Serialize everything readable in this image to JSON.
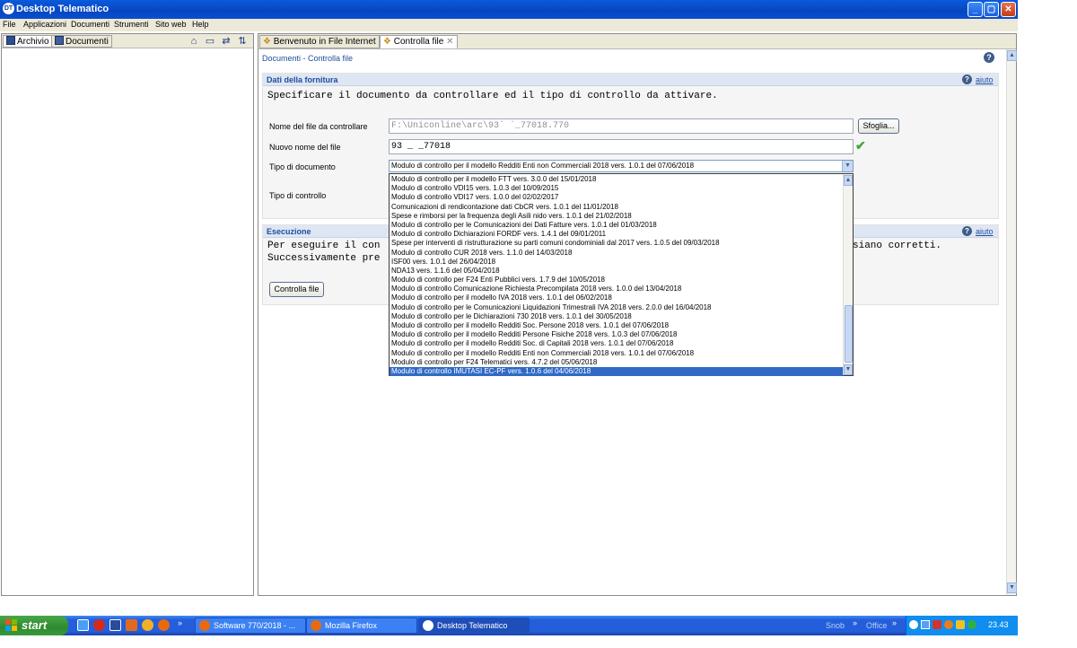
{
  "window": {
    "title": "Desktop Telematico",
    "app_icon_text": "DT",
    "minimize": "_",
    "maximize": "▢",
    "close": "✕"
  },
  "menu": [
    "File",
    "Applicazioni",
    "Documenti",
    "Strumenti",
    "Sito web",
    "Help"
  ],
  "left_panel": {
    "tabs": [
      "Archivio",
      "Documenti"
    ]
  },
  "right_panel": {
    "tabs": [
      "Benvenuto in File Internet",
      "Controlla file"
    ],
    "breadcrumb": "Documenti - Controlla file",
    "help_icon_text": "?"
  },
  "dati_fornitura": {
    "header": "Dati della fornitura",
    "aiuto": "aiuto",
    "instruction": "Specificare il documento da controllare ed il tipo di controllo da attivare.",
    "file_label": "Nome del file da controllare",
    "file_value": "F:\\Uniconline\\arc\\93`       `_77018.770",
    "browse_button": "Sfoglia...",
    "new_name_label": "Nuovo nome del file",
    "new_name_value": "93        _ _77018",
    "tipo_documento_label": "Tipo di documento",
    "tipo_documento_value": "Modulo di controllo per il modello Redditi Enti non Commerciali 2018 vers. 1.0.1 del 07/06/2018",
    "tipo_controllo_label": "Tipo di controllo"
  },
  "esecuzione": {
    "header": "Esecuzione",
    "aiuto": "aiuto",
    "line1_start": "Per eseguire il con",
    "line1_end": "siano corretti.",
    "line2_start": "Successivamente pre",
    "button": "Controlla file"
  },
  "dropdown_options": [
    "Modulo di controllo per il modello FTT vers. 3.0.0 del 15/01/2018",
    "Modulo di controllo VDI15 vers. 1.0.3 del 10/09/2015",
    "Modulo di controllo VDI17 vers. 1.0.0 del 02/02/2017",
    "Comunicazioni di rendicontazione dati CbCR vers. 1.0.1 del 11/01/2018",
    "Spese e rimborsi per la frequenza degli Asili nido vers. 1.0.1 del 21/02/2018",
    "Modulo di controllo per le Comunicazioni dei Dati Fatture vers. 1.0.1 del 01/03/2018",
    "Modulo di controllo Dichiarazioni FORDF vers. 1.4.1 del 09/01/2011",
    "Spese per interventi di ristrutturazione su parti comuni condominiali dal 2017 vers. 1.0.5 del 09/03/2018",
    "Modulo di controllo CUR 2018 vers. 1.1.0 del 14/03/2018",
    "ISF00 vers. 1.0.1 del 26/04/2018",
    "NDA13 vers. 1.1.6 del 05/04/2018",
    "Modulo di controllo per F24 Enti Pubblici vers. 1.7.9 del 10/05/2018",
    "Modulo di controllo Comunicazione Richiesta Precompilata 2018 vers. 1.0.0 del 13/04/2018",
    "Modulo di controllo per il modello IVA 2018 vers. 1.0.1 del 06/02/2018",
    "Modulo di controllo per le Comunicazioni Liquidazioni Trimestrali IVA 2018 vers. 2.0.0 del 16/04/2018",
    "Modulo di controllo per le Dichiarazioni 730 2018 vers. 1.0.1 del 30/05/2018",
    "Modulo di controllo per il modello Redditi Soc. Persone 2018 vers. 1.0.1 del 07/06/2018",
    "Modulo di controllo per il modello Redditi Persone Fisiche 2018 vers. 1.0.3 del 07/06/2018",
    "Modulo di controllo per il modello Redditi Soc. di Capitali 2018 vers. 1.0.1 del 07/06/2018",
    "Modulo di controllo per il modello Redditi Enti non Commerciali 2018 vers. 1.0.1 del 07/06/2018",
    "Modulo di controllo per F24 Telematici vers. 4.7.2 del 05/06/2018",
    "Modulo di controllo IMUTASI EC-PF vers. 1.0.6 del 04/06/2018"
  ],
  "dropdown_selected_index": 21,
  "taskbar": {
    "start": "start",
    "tasks": [
      "Software 770/2018 - ...",
      "Mozilla Firefox",
      "Desktop Telematico"
    ],
    "snob": "Snob",
    "office": "Office",
    "clock": "23.43"
  },
  "colors": {
    "titlebar": "#0a5bdc",
    "accent": "#1e4fa0",
    "selection": "#316ac5",
    "taskbar": "#245edb",
    "start": "#3a9a3a"
  }
}
